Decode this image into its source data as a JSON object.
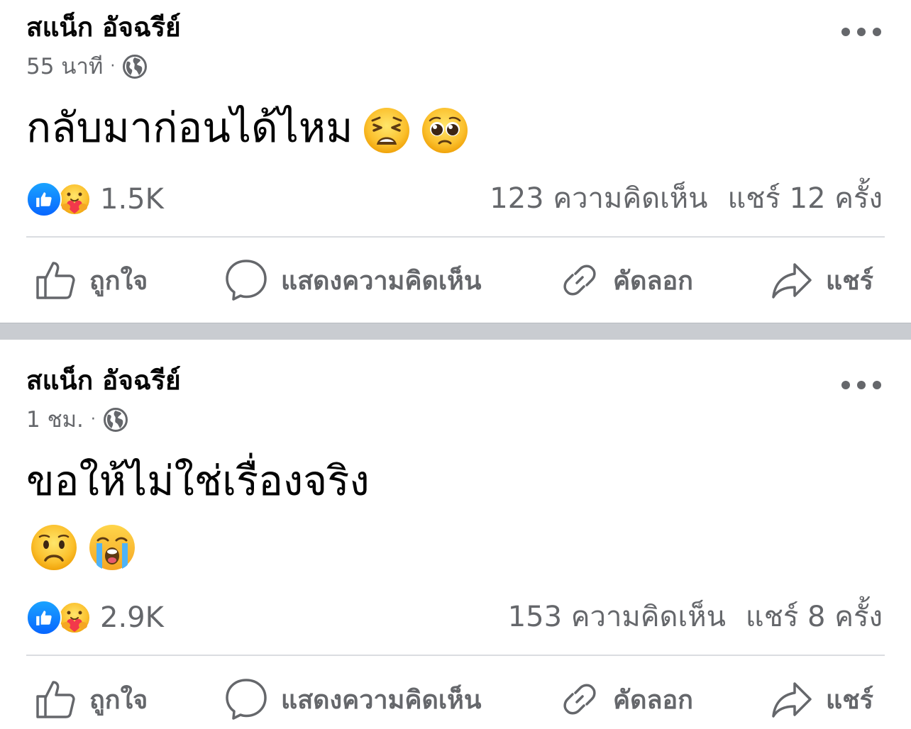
{
  "posts": [
    {
      "author": "สแน็ก อัจฉรีย์",
      "time": "55 นาที",
      "separator_dot": "·",
      "text": "กลับมาก่อนได้ไหม",
      "text_emojis": [
        "weary-face",
        "pleading-face"
      ],
      "reaction_count": "1.5K",
      "reaction_types": [
        "like",
        "care"
      ],
      "comments": "123 ความคิดเห็น",
      "shares": "แชร์ 12 ครั้ง"
    },
    {
      "author": "สแน็ก อัจฉรีย์",
      "time": "1 ชม.",
      "separator_dot": "·",
      "text": "ขอให้ไม่ใช่เรื่องจริง",
      "text_emojis": [
        "worried-face",
        "loudly-crying-face"
      ],
      "reaction_count": "2.9K",
      "reaction_types": [
        "like",
        "care"
      ],
      "comments": "153 ความคิดเห็น",
      "shares": "แชร์ 8 ครั้ง"
    }
  ],
  "actions": {
    "like": "ถูกใจ",
    "comment": "แสดงความคิดเห็น",
    "copy": "คัดลอก",
    "share": "แชร์"
  },
  "colors": {
    "text": "#050505",
    "secondary": "#65676b",
    "like_blue": "#0866ff",
    "separator": "#c9ccd1",
    "divider": "#dadde1"
  }
}
